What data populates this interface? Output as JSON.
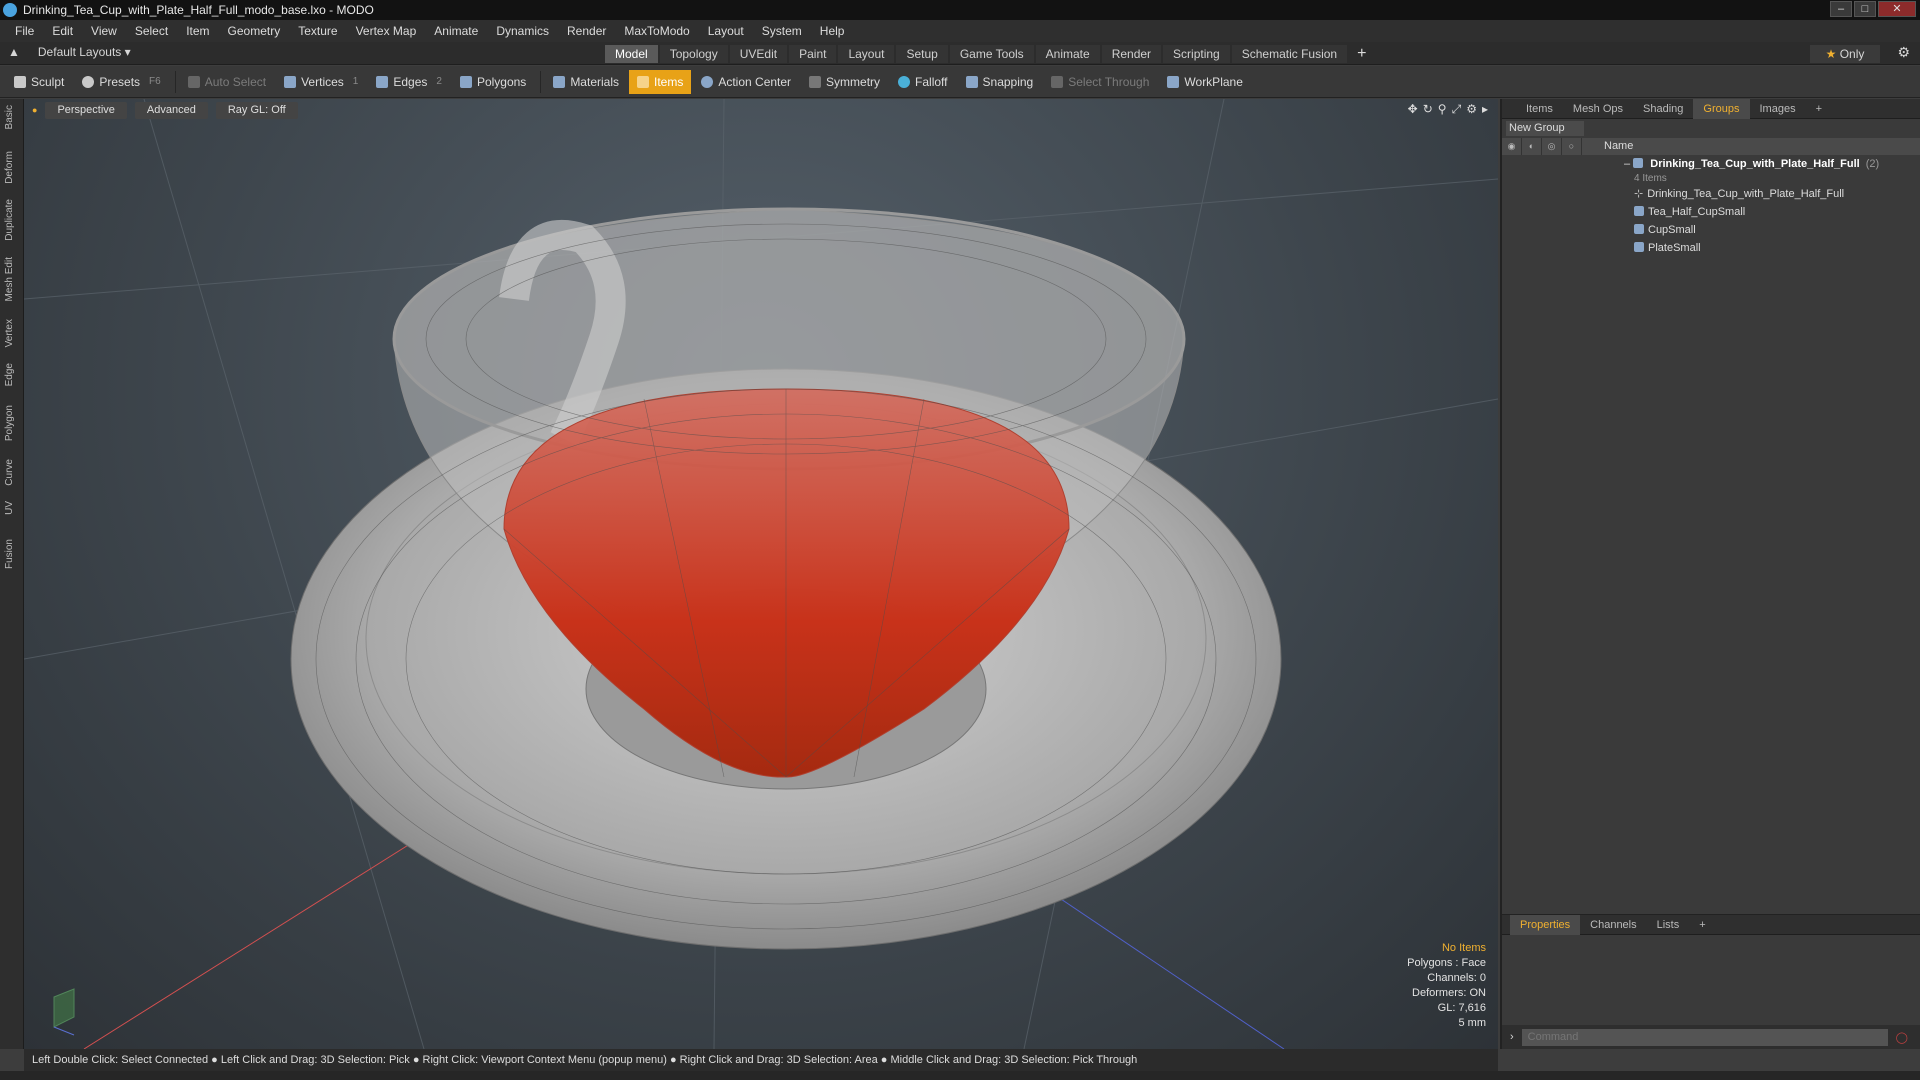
{
  "window": {
    "title": "Drinking_Tea_Cup_with_Plate_Half_Full_modo_base.lxo - MODO"
  },
  "menu": [
    "File",
    "Edit",
    "View",
    "Select",
    "Item",
    "Geometry",
    "Texture",
    "Vertex Map",
    "Animate",
    "Dynamics",
    "Render",
    "MaxToModo",
    "Layout",
    "System",
    "Help"
  ],
  "tabbar": {
    "layouts_label": "Default Layouts",
    "tabs": [
      "Model",
      "Topology",
      "UVEdit",
      "Paint",
      "Layout",
      "Setup",
      "Game Tools",
      "Animate",
      "Render",
      "Scripting",
      "Schematic Fusion"
    ],
    "plus": "+",
    "only_label": "Only"
  },
  "toolbar": {
    "sculpt": "Sculpt",
    "presets": "Presets",
    "presets_key": "F6",
    "auto_select": "Auto Select",
    "vertices": "Vertices",
    "vertices_count": "1",
    "edges": "Edges",
    "edges_count": "2",
    "polygons": "Polygons",
    "materials": "Materials",
    "items": "Items",
    "action_center": "Action Center",
    "symmetry": "Symmetry",
    "falloff": "Falloff",
    "snapping": "Snapping",
    "select_through": "Select Through",
    "workplane": "WorkPlane"
  },
  "left_tabs": [
    "Basic",
    "Deform",
    "Duplicate",
    "Mesh Edit",
    "Vertex",
    "Edge",
    "Polygon",
    "Curve",
    "UV",
    "Fusion"
  ],
  "viewport": {
    "perspective": "Perspective",
    "advanced": "Advanced",
    "raygl": "Ray GL: Off",
    "info": {
      "no_items": "No Items",
      "polygons": "Polygons : Face",
      "channels": "Channels: 0",
      "deformers": "Deformers: ON",
      "gl": "GL: 7,616",
      "units": "5 mm"
    }
  },
  "panel": {
    "tabs": [
      "Items",
      "Mesh Ops",
      "Shading",
      "Groups",
      "Images"
    ],
    "plus": "+",
    "new_group": "New Group",
    "name_header": "Name",
    "group": {
      "name": "Drinking_Tea_Cup_with_Plate_Half_Full",
      "count": "(2)",
      "sub": "4 Items"
    },
    "children": [
      "Drinking_Tea_Cup_with_Plate_Half_Full",
      "Tea_Half_CupSmall",
      "CupSmall",
      "PlateSmall"
    ]
  },
  "props": {
    "tabs": [
      "Properties",
      "Channels",
      "Lists"
    ],
    "plus": "+",
    "command_placeholder": "Command"
  },
  "status": "Left Double Click: Select Connected ● Left Click and Drag: 3D Selection: Pick ● Right Click: Viewport Context Menu (popup menu) ● Right Click and Drag: 3D Selection: Area ● Middle Click and Drag: 3D Selection: Pick Through",
  "colors": {
    "accent": "#e8a217",
    "tea": "#c8321a",
    "viewport_bg": "#3e464d"
  }
}
